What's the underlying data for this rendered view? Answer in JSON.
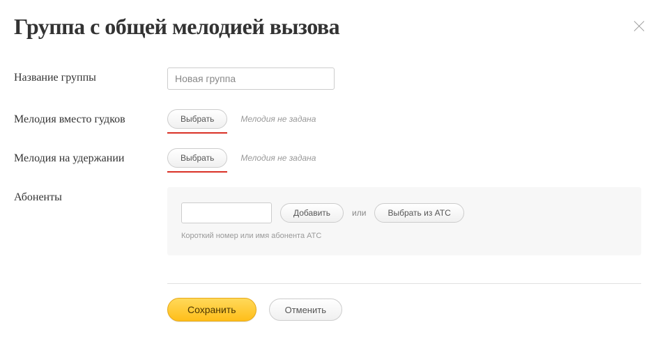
{
  "header": {
    "title": "Группа с общей мелодией вызова"
  },
  "form": {
    "name": {
      "label": "Название группы",
      "value": "Новая группа"
    },
    "ringback": {
      "label": "Мелодия вместо гудков",
      "select_button": "Выбрать",
      "status": "Мелодия не задана"
    },
    "hold": {
      "label": "Мелодия на удержании",
      "select_button": "Выбрать",
      "status": "Мелодия не задана"
    },
    "subscribers": {
      "label": "Абоненты",
      "add_button": "Добавить",
      "or_text": "или",
      "select_from_ats": "Выбрать из АТС",
      "hint": "Короткий номер или имя абонента АТС"
    }
  },
  "footer": {
    "save": "Сохранить",
    "cancel": "Отменить"
  }
}
